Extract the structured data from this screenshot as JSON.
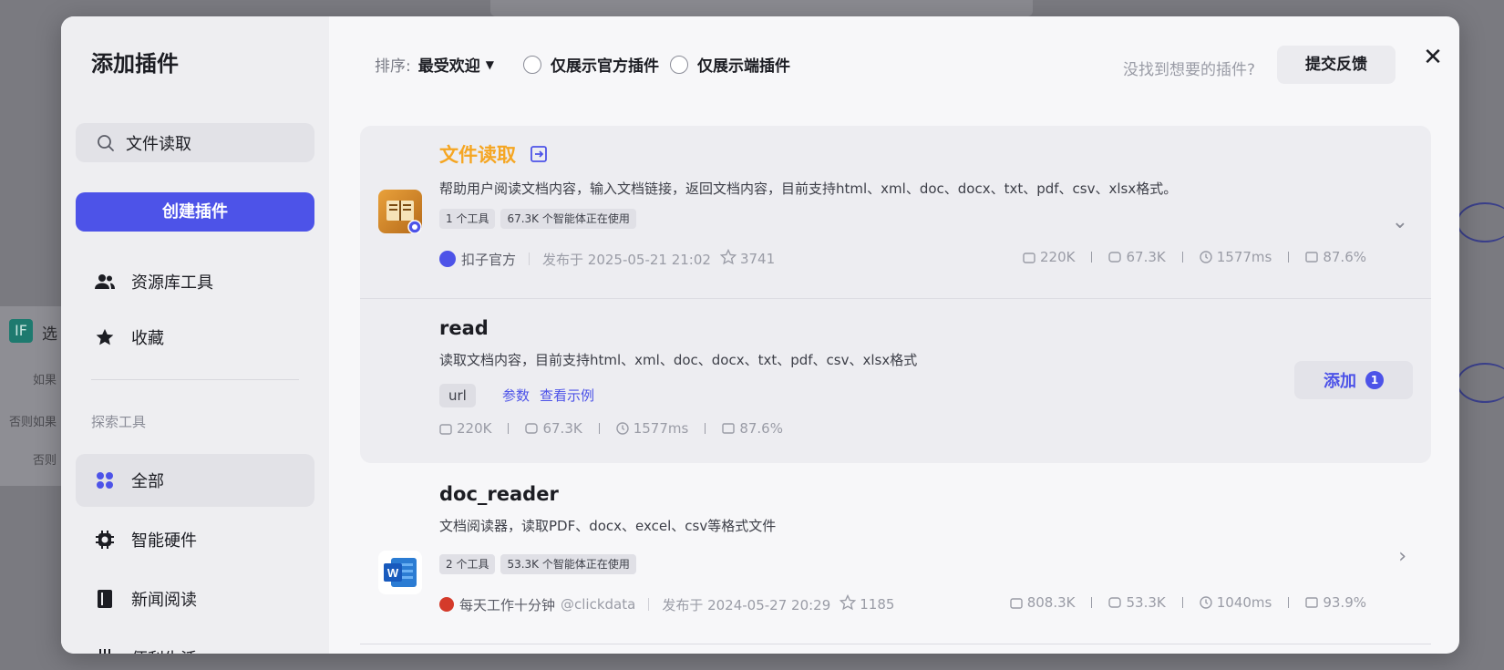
{
  "background": {
    "node_badge": "IF",
    "node_title": "选",
    "node_lines": [
      "如果",
      "否则如果",
      "否则"
    ]
  },
  "modal": {
    "title": "添加插件",
    "search": {
      "value": "文件读取",
      "icon": "search-icon"
    },
    "create_button": "创建插件",
    "nav": [
      {
        "label": "资源库工具",
        "icon": "users-icon"
      },
      {
        "label": "收藏",
        "icon": "star-icon"
      }
    ],
    "explore_section": "探索工具",
    "explore_nav": [
      {
        "label": "全部",
        "icon": "grid-icon",
        "active": true
      },
      {
        "label": "智能硬件",
        "icon": "chip-icon"
      },
      {
        "label": "新闻阅读",
        "icon": "book-icon"
      },
      {
        "label": "便利生活",
        "icon": "calendar-icon"
      }
    ]
  },
  "toolbar": {
    "sort_label": "排序:",
    "sort_value": "最受欢迎",
    "filter_official": "仅展示官方插件",
    "filter_device": "仅展示端插件",
    "not_found": "没找到想要的插件?",
    "feedback_button": "提交反馈"
  },
  "plugins": [
    {
      "name": "文件读取",
      "description": "帮助用户阅读文档内容，输入文档链接，返回文档内容，目前支持html、xml、doc、docx、txt、pdf、csv、xlsx格式。",
      "tags": [
        "1 个工具",
        "67.3K 个智能体正在使用"
      ],
      "author": "扣子官方",
      "published": "发布于 2025-05-21 21:02",
      "stars": "3741",
      "stats": [
        "220K",
        "67.3K",
        "1577ms",
        "87.6%"
      ],
      "accent": "#f5a623",
      "tool": {
        "name": "read",
        "description": "读取文档内容，目前支持html、xml、doc、docx、txt、pdf、csv、xlsx格式",
        "param": "url",
        "params_link": "参数",
        "example_link": "查看示例",
        "stats": [
          "220K",
          "67.3K",
          "1577ms",
          "87.6%"
        ],
        "add_button": "添加",
        "add_count": "1"
      }
    },
    {
      "name": "doc_reader",
      "description": "文档阅读器，读取PDF、docx、excel、csv等格式文件",
      "tags": [
        "2 个工具",
        "53.3K 个智能体正在使用"
      ],
      "author": "每天工作十分钟",
      "handle": "@clickdata",
      "published": "发布于 2024-05-27 20:29",
      "stars": "1185",
      "stats": [
        "808.3K",
        "53.3K",
        "1040ms",
        "93.9%"
      ]
    }
  ]
}
